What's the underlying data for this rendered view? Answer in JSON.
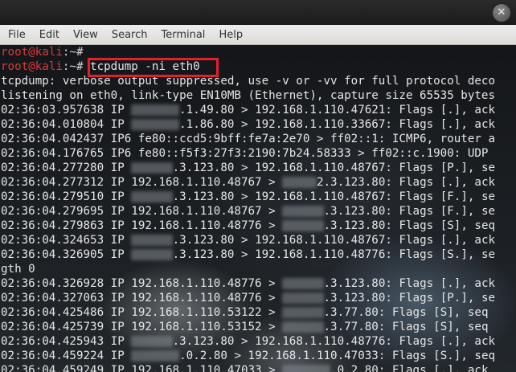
{
  "window": {
    "close_glyph": "✕"
  },
  "menubar": {
    "items": [
      "File",
      "Edit",
      "View",
      "Search",
      "Terminal",
      "Help"
    ]
  },
  "terminal": {
    "prompt": {
      "user_host": "root@kali",
      "sep": ":~#",
      "sep_cmd": ":~# "
    },
    "command": "tcpdump -ni eth0",
    "highlight_color": "#e0202a",
    "output": [
      {
        "parts": [
          "tcpdump: verbose output suppressed, use -v or -vv for full protocol deco"
        ]
      },
      {
        "parts": [
          "listening on eth0, link-type EN10MB (Ethernet), capture size 65535 bytes"
        ]
      },
      {
        "parts": [
          "02:36:03.957638 IP ",
          "",
          ".1.49.80 > 192.168.1.110.47621: Flags [.], ack"
        ],
        "blur_chars": 7
      },
      {
        "parts": [
          "02:36:04.010804 IP ",
          "",
          ".1.86.80 > 192.168.1.110.33667: Flags [.], ack"
        ],
        "blur_chars": 7
      },
      {
        "parts": [
          "02:36:04.042437 IP6 fe80::ccd5:9bff:fe7a:2e70 > ff02::1: ICMP6, router a"
        ]
      },
      {
        "parts": [
          "02:36:04.176765 IP6 fe80::f5f3:27f3:2190:7b24.58333 > ff02::c.1900: UDP"
        ]
      },
      {
        "parts": [
          "02:36:04.277280 IP ",
          "",
          ".3.123.80 > 192.168.1.110.48767: Flags [P.], se"
        ],
        "blur_chars": 6
      },
      {
        "parts": [
          "02:36:04.277312 IP 192.168.1.110.48767 > ",
          "",
          "2.3.123.80: Flags [.], ack"
        ],
        "blur_chars": 5
      },
      {
        "parts": [
          "02:36:04.279510 IP ",
          "",
          ".3.123.80 > 192.168.1.110.48767: Flags [F.], se"
        ],
        "blur_chars": 6
      },
      {
        "parts": [
          "02:36:04.279695 IP 192.168.1.110.48767 > ",
          "",
          ".3.123.80: Flags [F.], se"
        ],
        "blur_chars": 6
      },
      {
        "parts": [
          "02:36:04.279863 IP 192.168.1.110.48776 > ",
          "",
          ".3.123.80: Flags [S], seq"
        ],
        "blur_chars": 6
      },
      {
        "parts": [
          "02:36:04.324653 IP ",
          "",
          ".3.123.80 > 192.168.1.110.48767: Flags [.], ack"
        ],
        "blur_chars": 6
      },
      {
        "parts": [
          "02:36:04.326905 IP ",
          "",
          ".3.123.80 > 192.168.1.110.48776: Flags [S.], se"
        ],
        "blur_chars": 6
      },
      {
        "parts": [
          "gth 0"
        ]
      },
      {
        "parts": [
          "02:36:04.326928 IP 192.168.1.110.48776 > ",
          "",
          ".3.123.80: Flags [.], ack"
        ],
        "blur_chars": 6
      },
      {
        "parts": [
          "02:36:04.327063 IP 192.168.1.110.48776 > ",
          "",
          ".3.123.80: Flags [P.], se"
        ],
        "blur_chars": 6
      },
      {
        "parts": [
          "02:36:04.425486 IP 192.168.1.110.53122 > ",
          "",
          ".3.77.80: Flags [S], seq"
        ],
        "blur_chars": 6
      },
      {
        "parts": [
          "02:36:04.425739 IP 192.168.1.110.53152 > ",
          "",
          ".3.77.80: Flags [S], seq"
        ],
        "blur_chars": 6
      },
      {
        "parts": [
          "02:36:04.425943 IP ",
          "",
          ".3.123.80 > 192.168.1.110.48776: Flags [.], ack"
        ],
        "blur_chars": 6
      },
      {
        "parts": [
          "02:36:04.459224 IP ",
          "",
          ".0.2.80 > 192.168.1.110.47033: Flags [S.], seq"
        ],
        "blur_chars": 7
      },
      {
        "parts": [
          "02:36:04.459249 IP 192.168.1.110.47033 > ",
          "",
          ".0.2.80: Flags [.], ack"
        ],
        "blur_chars": 7
      }
    ]
  }
}
